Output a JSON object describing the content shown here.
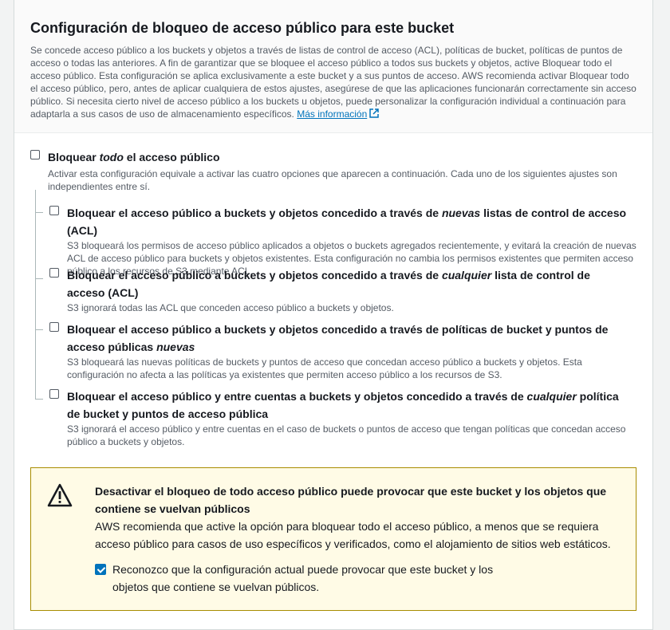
{
  "header": {
    "title": "Configuración de bloqueo de acceso público para este bucket",
    "description": "Se concede acceso público a los buckets y objetos a través de listas de control de acceso (ACL), políticas de bucket, políticas de puntos de acceso o todas las anteriores. A fin de garantizar que se bloquee el acceso público a todos sus buckets y objetos, active Bloquear todo el acceso público. Esta configuración se aplica exclusivamente a este bucket y a sus puntos de acceso. AWS recomienda activar Bloquear todo el acceso público, pero, antes de aplicar cualquiera de estos ajustes, asegúrese de que las aplicaciones funcionarán correctamente sin acceso público. Si necesita cierto nivel de acceso público a los buckets u objetos, puede personalizar la configuración individual a continuación para adaptarla a sus casos de uso de almacenamiento específicos.",
    "learn_more": "Más información"
  },
  "block_all": {
    "label_pre": "Bloquear ",
    "label_em": "todo",
    "label_post": " el acceso público",
    "description": "Activar esta configuración equivale a activar las cuatro opciones que aparecen a continuación. Cada uno de los siguientes ajustes son independientes entre sí.",
    "checked": false
  },
  "options": [
    {
      "label_pre": "Bloquear el acceso público a buckets y objetos concedido a través de ",
      "label_em": "nuevas",
      "label_post": " listas de control de acceso (ACL)",
      "description": "S3 bloqueará los permisos de acceso público aplicados a objetos o buckets agregados recientemente, y evitará la creación de nuevas ACL de acceso público para buckets y objetos existentes. Esta configuración no cambia los permisos existentes que permiten acceso público a los recursos de S3 mediante ACL.",
      "checked": false
    },
    {
      "label_pre": "Bloquear el acceso público a buckets y objetos concedido a través de ",
      "label_em": "cualquier",
      "label_post": " lista de control de acceso (ACL)",
      "description": "S3 ignorará todas las ACL que conceden acceso público a buckets y objetos.",
      "checked": false
    },
    {
      "label_pre": "Bloquear el acceso público a buckets y objetos concedido a través de políticas de bucket y puntos de acceso públicas ",
      "label_em": "nuevas",
      "label_post": "",
      "description": "S3 bloqueará las nuevas políticas de buckets y puntos de acceso que concedan acceso público a buckets y objetos. Esta configuración no afecta a las políticas ya existentes que permiten acceso público a los recursos de S3.",
      "checked": false
    },
    {
      "label_pre": "Bloquear el acceso público y entre cuentas a buckets y objetos concedido a través de ",
      "label_em": "cualquier",
      "label_post": " política de bucket y puntos de acceso pública",
      "description": "S3 ignorará el acceso público y entre cuentas en el caso de buckets o puntos de acceso que tengan políticas que concedan acceso público a buckets y objetos.",
      "checked": false
    }
  ],
  "alert": {
    "title": "Desactivar el bloqueo de todo acceso público puede provocar que este bucket y los objetos que contiene se vuelvan públicos",
    "text": "AWS recomienda que active la opción para bloquear todo el acceso público, a menos que se requiera acceso público para casos de uso específicos y verificados, como el alojamiento de sitios web estáticos.",
    "ack_label": "Reconozco que la configuración actual puede provocar que este bucket y los objetos que contiene se vuelvan públicos.",
    "ack_checked": true,
    "color_border": "#a88c00",
    "color_bg": "#fffbe6"
  },
  "colors": {
    "link": "#0073bb",
    "checkbox_checked": "#0073bb"
  }
}
